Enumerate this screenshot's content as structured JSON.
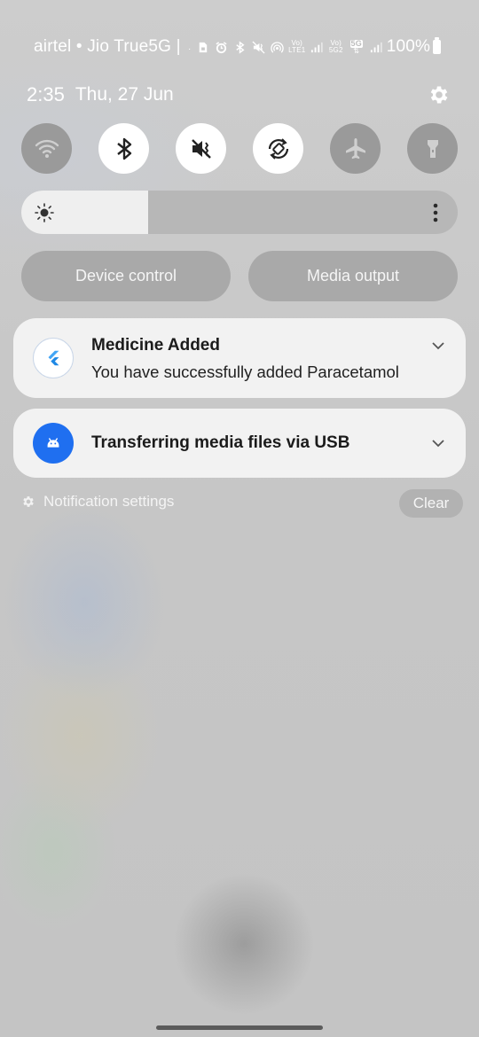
{
  "status_bar": {
    "carrier_text": "airtel • Jio True5G |",
    "icons": [
      "dot",
      "sim-lock-icon",
      "alarm-icon",
      "bluetooth-icon",
      "vibrate-mute-icon",
      "hotspot-icon",
      "volte-lte1-icon",
      "signal-icon",
      "volte-5g2-icon",
      "5g-data-icon",
      "signal-icon"
    ],
    "volte1_top": "Vo)",
    "volte1_bottom": "LTE1",
    "volte2_top": "Vo)",
    "volte2_bottom": "5G2",
    "fiveg_badge": "5G",
    "battery_text": "100%"
  },
  "header": {
    "time": "2:35",
    "date": "Thu, 27 Jun",
    "settings_icon": "gear-icon"
  },
  "quick_tiles": [
    {
      "name": "wifi",
      "icon": "wifi-icon",
      "state": "off"
    },
    {
      "name": "bluetooth",
      "icon": "bluetooth-icon",
      "state": "on"
    },
    {
      "name": "sound",
      "icon": "mute-vibrate-icon",
      "state": "on"
    },
    {
      "name": "auto-rotate",
      "icon": "rotate-icon",
      "state": "on"
    },
    {
      "name": "airplane",
      "icon": "airplane-icon",
      "state": "off"
    },
    {
      "name": "torch",
      "icon": "flashlight-icon",
      "state": "off"
    }
  ],
  "brightness": {
    "level_fraction": 0.29,
    "icon": "sun-icon",
    "more_icon": "more-vert-icon"
  },
  "buttons": {
    "device_control": "Device control",
    "media_output": "Media output"
  },
  "notifications": [
    {
      "app_icon": "flutter-icon",
      "title": "Medicine Added",
      "body": "You have successfully added Paracetamol"
    },
    {
      "app_icon": "usb-android-icon",
      "title": "Transferring media files via USB",
      "body": ""
    }
  ],
  "footer": {
    "notification_settings": "Notification settings",
    "clear": "Clear"
  },
  "colors": {
    "tile_on": "#ffffff",
    "tile_off": "#9a9a9a",
    "usb_icon_bg": "#1f6ff0",
    "flutter_blue": "#42a5f5"
  }
}
